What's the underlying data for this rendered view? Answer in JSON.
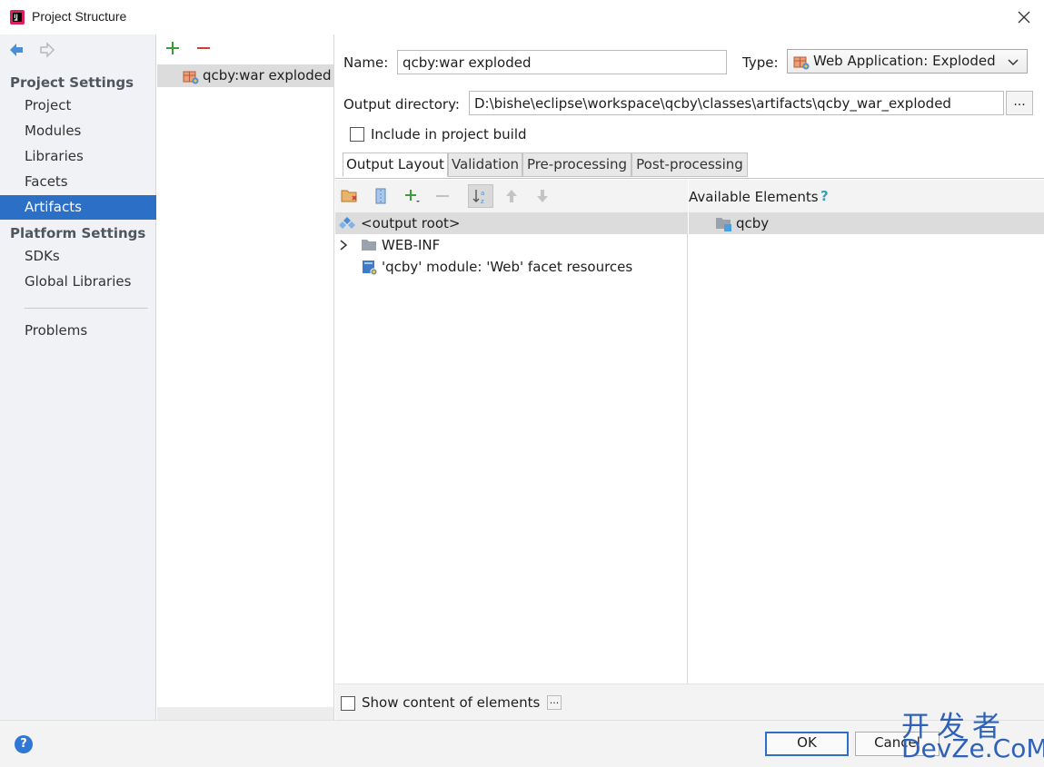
{
  "window": {
    "title": "Project Structure"
  },
  "sidebar": {
    "project_settings_heading": "Project Settings",
    "project_items": [
      {
        "label": "Project"
      },
      {
        "label": "Modules"
      },
      {
        "label": "Libraries"
      },
      {
        "label": "Facets"
      },
      {
        "label": "Artifacts",
        "selected": true
      }
    ],
    "platform_settings_heading": "Platform Settings",
    "platform_items": [
      {
        "label": "SDKs"
      },
      {
        "label": "Global Libraries"
      }
    ],
    "problems_label": "Problems"
  },
  "artifacts": {
    "items": [
      {
        "label": "qcby:war exploded",
        "selected": true
      }
    ]
  },
  "form": {
    "name_label": "Name:",
    "name_value": "qcby:war exploded",
    "type_label": "Type:",
    "type_value": "Web Application: Exploded",
    "output_dir_label": "Output directory:",
    "output_dir_value": "D:\\bishe\\eclipse\\workspace\\qcby\\classes\\artifacts\\qcby_war_exploded",
    "browse_label": "...",
    "include_build_label": "Include in project build",
    "include_build_checked": false
  },
  "tabs": [
    {
      "label": "Output Layout",
      "active": true
    },
    {
      "label": "Validation"
    },
    {
      "label": "Pre-processing"
    },
    {
      "label": "Post-processing"
    }
  ],
  "layout_tree": [
    {
      "label": "<output root>",
      "icon": "output-root-icon",
      "selected": true
    },
    {
      "label": "WEB-INF",
      "icon": "folder-icon",
      "expandable": true
    },
    {
      "label": "'qcby' module: 'Web' facet resources",
      "icon": "web-facet-icon"
    }
  ],
  "available": {
    "heading": "Available Elements",
    "help": "?",
    "items": [
      {
        "label": "qcby",
        "icon": "module-folder-icon"
      }
    ]
  },
  "bottom": {
    "show_content_label": "Show content of elements",
    "show_content_checked": false,
    "more_label": "..."
  },
  "footer": {
    "help": "?",
    "ok_label": "OK",
    "cancel_label": "Cancel"
  },
  "watermark": {
    "cn": "开发者",
    "en": "DevZe.CoM"
  },
  "colors": {
    "accent": "#2b6fc7",
    "selection": "#dcdcdc",
    "add": "#3a9c3a",
    "remove": "#d23b3b"
  }
}
